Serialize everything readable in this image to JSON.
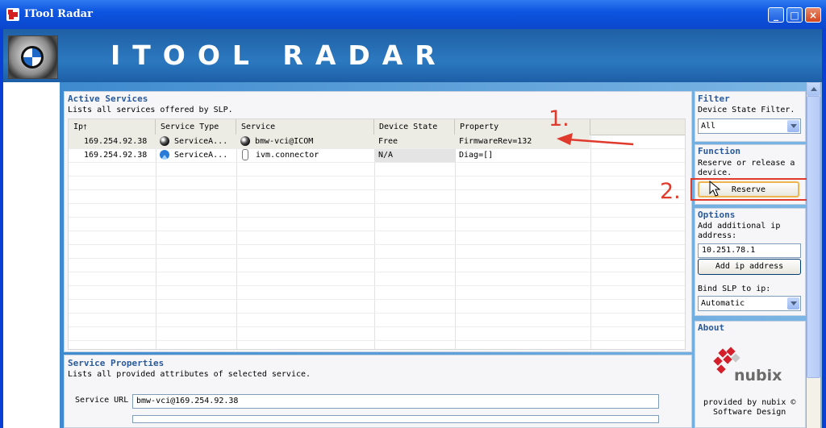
{
  "window": {
    "title": "ITool Radar",
    "banner_title": "ITOOL RADAR"
  },
  "active_services": {
    "title": "Active Services",
    "desc": "Lists all services offered by SLP.",
    "columns": [
      "Ip",
      "Service Type",
      "Service",
      "Device State",
      "Property"
    ],
    "rows": [
      {
        "ip": "169.254.92.38",
        "service_type": "ServiceA...",
        "service": "bmw-vci@ICOM",
        "device_state": "Free",
        "property": "FirmwareRev=132"
      },
      {
        "ip": "169.254.92.38",
        "service_type": "ServiceA...",
        "service": "ivm.connector",
        "device_state": "N/A",
        "property": "Diag=[]"
      }
    ]
  },
  "annotations": {
    "step1": "1.",
    "step2": "2."
  },
  "service_properties": {
    "title": "Service Properties",
    "desc": "Lists all provided attributes of selected service.",
    "url_label": "Service URL",
    "url_value": "bmw-vci@169.254.92.38"
  },
  "filter": {
    "title": "Filter",
    "label": "Device State Filter.",
    "selected": "All"
  },
  "function": {
    "title": "Function",
    "desc": "Reserve or release  a device.",
    "button": "Reserve"
  },
  "options": {
    "title": "Options",
    "desc": "Add additional ip address:",
    "ip_value": "10.251.78.1",
    "add_button": "Add ip address",
    "bind_label": "Bind SLP to ip:",
    "bind_selected": "Automatic"
  },
  "about": {
    "title": "About",
    "logo_text": "nubix",
    "provided_by": "provided by nubix ©",
    "software_design": "Software Design"
  },
  "icons": [
    "app-icon",
    "bmw-logo-icon",
    "minimize-icon",
    "maximize-icon",
    "close-icon",
    "globe-icon",
    "service-blue-icon",
    "connector-icon",
    "dropdown-arrow-icon",
    "arrow-annotation-icon",
    "cursor-icon",
    "nubix-logo-icon",
    "sort-indicator-icon"
  ],
  "colors": {
    "accent": "#2a5a9a",
    "annotation_red": "#e03a2c",
    "titlebar": "#0d55e0",
    "banner": "#2c79c0"
  }
}
